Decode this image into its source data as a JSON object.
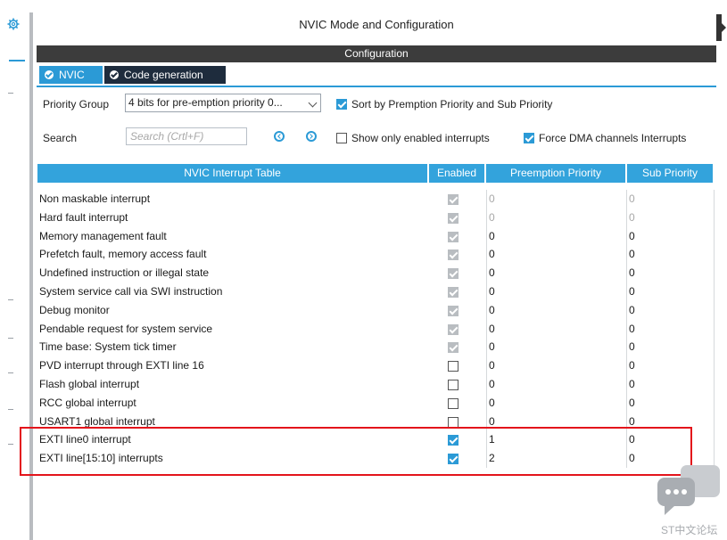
{
  "window": {
    "title": "NVIC Mode and Configuration"
  },
  "configuration_label": "Configuration",
  "tabs": [
    {
      "label": "NVIC",
      "active": true
    },
    {
      "label": "Code generation",
      "active": false
    }
  ],
  "priority_group": {
    "label": "Priority Group",
    "value": "4 bits for pre-emption priority 0..."
  },
  "sort_option": {
    "label": "Sort by Premption Priority and Sub Priority",
    "checked": true
  },
  "search": {
    "label": "Search",
    "placeholder": "Search (Crtl+F)"
  },
  "show_enabled_option": {
    "label": "Show only enabled interrupts",
    "checked": false
  },
  "force_dma_option": {
    "label": "Force DMA channels Interrupts",
    "checked": true
  },
  "table": {
    "columns": [
      "NVIC Interrupt Table",
      "Enabled",
      "Preemption Priority",
      "Sub Priority"
    ],
    "rows": [
      {
        "name": "Non maskable interrupt",
        "enabled": "locked",
        "preemption": "0",
        "sub": "0",
        "dim": true
      },
      {
        "name": "Hard fault interrupt",
        "enabled": "locked",
        "preemption": "0",
        "sub": "0",
        "dim": true
      },
      {
        "name": "Memory management fault",
        "enabled": "locked",
        "preemption": "0",
        "sub": "0",
        "dim": false
      },
      {
        "name": "Prefetch fault, memory access fault",
        "enabled": "locked",
        "preemption": "0",
        "sub": "0",
        "dim": false
      },
      {
        "name": "Undefined instruction or illegal state",
        "enabled": "locked",
        "preemption": "0",
        "sub": "0",
        "dim": false
      },
      {
        "name": "System service call via SWI instruction",
        "enabled": "locked",
        "preemption": "0",
        "sub": "0",
        "dim": false
      },
      {
        "name": "Debug monitor",
        "enabled": "locked",
        "preemption": "0",
        "sub": "0",
        "dim": false
      },
      {
        "name": "Pendable request for system service",
        "enabled": "locked",
        "preemption": "0",
        "sub": "0",
        "dim": false
      },
      {
        "name": "Time base: System tick timer",
        "enabled": "locked",
        "preemption": "0",
        "sub": "0",
        "dim": false
      },
      {
        "name": "PVD interrupt through EXTI line 16",
        "enabled": "off",
        "preemption": "0",
        "sub": "0",
        "dim": false
      },
      {
        "name": "Flash global interrupt",
        "enabled": "off",
        "preemption": "0",
        "sub": "0",
        "dim": false
      },
      {
        "name": "RCC global interrupt",
        "enabled": "off",
        "preemption": "0",
        "sub": "0",
        "dim": false
      },
      {
        "name": "USART1 global interrupt",
        "enabled": "off",
        "preemption": "0",
        "sub": "0",
        "dim": false
      },
      {
        "name": "EXTI line0 interrupt",
        "enabled": "on",
        "preemption": "1",
        "sub": "0",
        "dim": false
      },
      {
        "name": "EXTI line[15:10] interrupts",
        "enabled": "on",
        "preemption": "2",
        "sub": "0",
        "dim": false
      }
    ]
  },
  "watermark": {
    "text": "ST中文论坛"
  },
  "colors": {
    "accent": "#2b9ad6",
    "header": "#3c3c3c",
    "highlight": "#e3141b",
    "dark_tab": "#1e2c3d"
  }
}
